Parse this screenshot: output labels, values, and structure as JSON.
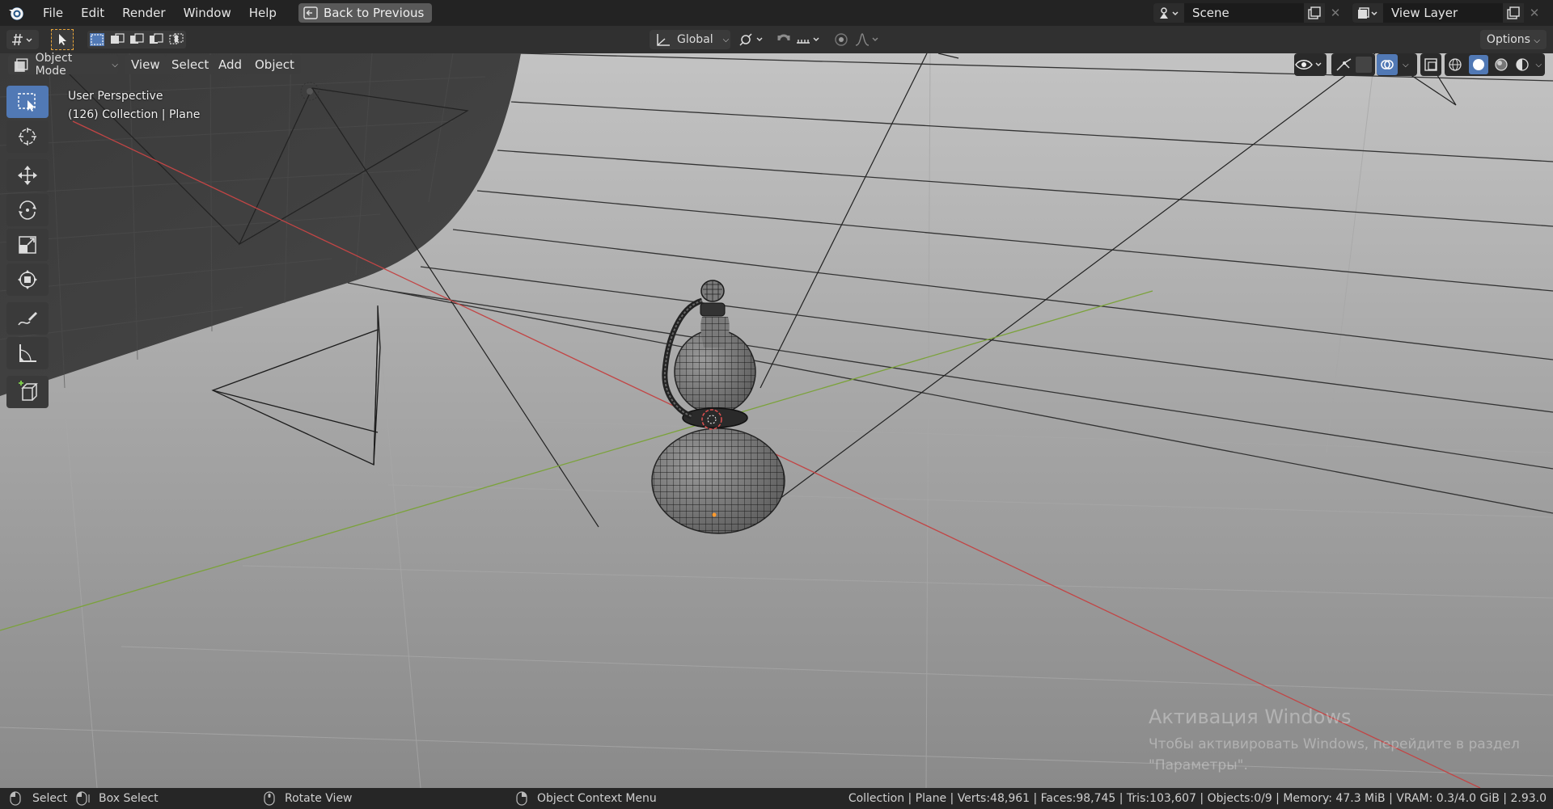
{
  "topbar": {
    "menus": [
      "File",
      "Edit",
      "Render",
      "Window",
      "Help"
    ],
    "back_button": "Back to Previous",
    "scene_name": "Scene",
    "view_layer_name": "View Layer"
  },
  "toolheader": {
    "orientation": "Global",
    "options_label": "Options"
  },
  "viewport_header": {
    "mode": "Object Mode",
    "menus": [
      "View",
      "Select",
      "Add",
      "Object"
    ]
  },
  "viewport": {
    "perspective": "User Perspective",
    "context": "(126) Collection | Plane",
    "background_color": "#8e8e8e",
    "axis_x_color": "#c24545",
    "axis_y_color": "#7ba23a"
  },
  "toolbar_icons": [
    "select-box-icon",
    "cursor-icon",
    "move-icon",
    "rotate-icon",
    "scale-icon",
    "transform-icon",
    "annotate-icon",
    "measure-icon",
    "add-cube-icon"
  ],
  "watermark": {
    "title": "Активация Windows",
    "line1": "Чтобы активировать Windows, перейдите в раздел",
    "line2": "\"Параметры\"."
  },
  "statusbar": {
    "select": "Select",
    "box_select": "Box Select",
    "rotate_view": "Rotate View",
    "context_menu": "Object Context Menu",
    "stats": "Collection | Plane | Verts:48,961 | Faces:98,745 | Tris:103,607 | Objects:0/9 | Memory: 47.3 MiB | VRAM: 0.3/4.0 GiB | 2.93.0"
  },
  "colors": {
    "accent": "#5179b5",
    "topbar": "#232323",
    "header": "#303030"
  }
}
